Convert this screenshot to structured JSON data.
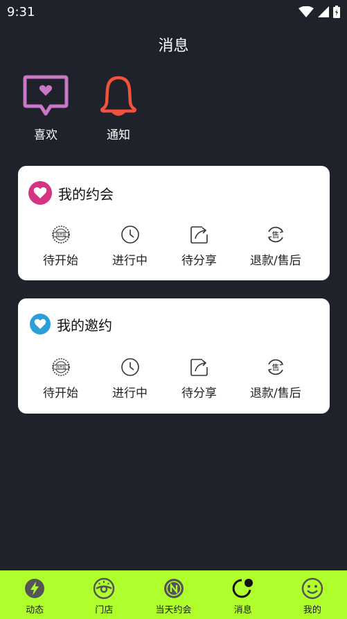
{
  "status": {
    "time": "9:31"
  },
  "header": {
    "title": "消息"
  },
  "shortcuts": [
    {
      "label": "喜欢",
      "icon": "chat-heart-icon",
      "color": "#c977c9"
    },
    {
      "label": "通知",
      "icon": "bell-icon",
      "color": "#f0523d"
    }
  ],
  "cards": [
    {
      "title": "我的约会",
      "badge_color": "#d63384",
      "items": [
        {
          "label": "待开始",
          "icon": "pending-stamp-icon"
        },
        {
          "label": "进行中",
          "icon": "clock-icon"
        },
        {
          "label": "待分享",
          "icon": "share-icon"
        },
        {
          "label": "退款/售后",
          "icon": "refund-icon"
        }
      ]
    },
    {
      "title": "我的邀约",
      "badge_color": "#2a9fd8",
      "items": [
        {
          "label": "待开始",
          "icon": "pending-stamp-icon"
        },
        {
          "label": "进行中",
          "icon": "clock-icon"
        },
        {
          "label": "待分享",
          "icon": "share-icon"
        },
        {
          "label": "退款/售后",
          "icon": "refund-icon"
        }
      ]
    }
  ],
  "stamp_text": "待开始",
  "refund_glyph": "售",
  "tabs": [
    {
      "label": "动态",
      "icon": "lightning-icon"
    },
    {
      "label": "门店",
      "icon": "store-icon"
    },
    {
      "label": "当天约会",
      "icon": "today-date-icon"
    },
    {
      "label": "消息",
      "icon": "message-icon",
      "active": true
    },
    {
      "label": "我的",
      "icon": "smile-icon"
    }
  ],
  "colors": {
    "background": "#1f212b",
    "tabbar": "#aeff2b",
    "card": "#ffffff"
  }
}
